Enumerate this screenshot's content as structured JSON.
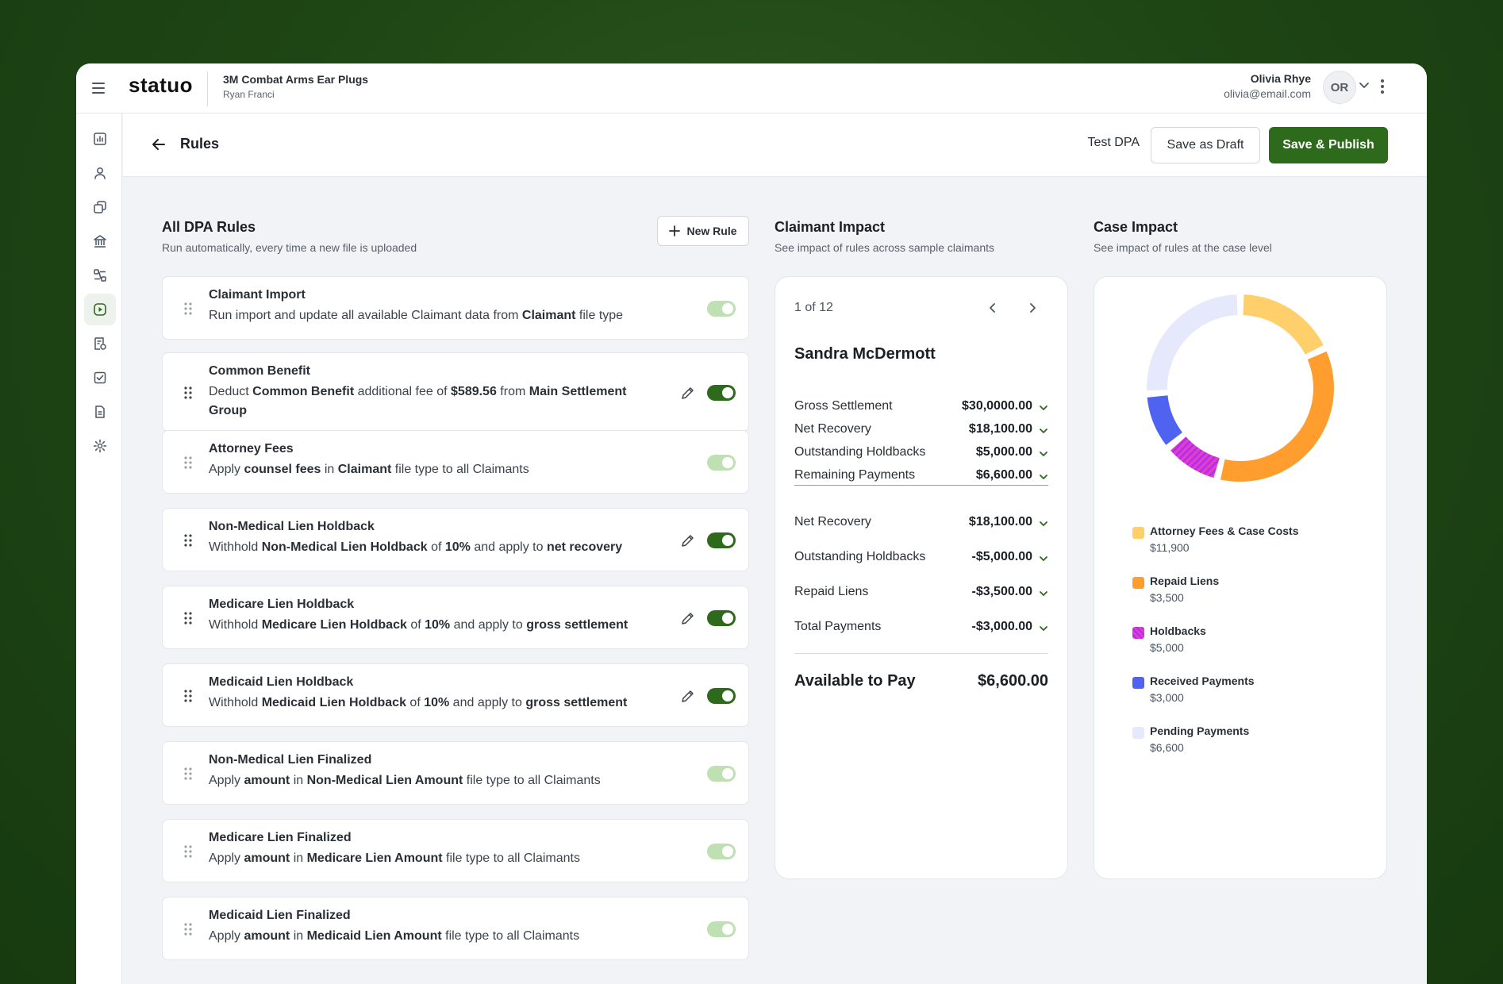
{
  "app": {
    "logo": "statuo",
    "case_title": "3M Combat Arms Ear Plugs",
    "case_subtitle": "Ryan Franci",
    "user_name": "Olivia Rhye",
    "user_email": "olivia@email.com",
    "avatar_initials": "OR"
  },
  "sidebar": {
    "icons": [
      "dashboard-icon",
      "user-icon",
      "copy-icon",
      "bank-icon",
      "workflow-icon",
      "play-icon",
      "receipt-icon",
      "checklist-icon",
      "document-icon",
      "settings-icon"
    ],
    "active_index": 5
  },
  "header": {
    "title": "Rules",
    "test_label": "Test DPA",
    "draft_label": "Save as Draft",
    "publish_label": "Save & Publish"
  },
  "rules_section": {
    "title": "All DPA Rules",
    "subtitle": "Run automatically, every time a new file is uploaded",
    "new_rule_label": "New Rule"
  },
  "rules": [
    {
      "title": "Claimant Import",
      "desc": [
        {
          "t": "Run import and update all available Claimant data from "
        },
        {
          "b": "Claimant"
        },
        {
          "t": " file type"
        }
      ],
      "toggle": "locked",
      "editable": false
    },
    {
      "title": "Common Benefit",
      "desc": [
        {
          "t": "Deduct "
        },
        {
          "b": "Common Benefit"
        },
        {
          "t": " additional fee of "
        },
        {
          "b": "$589.56"
        },
        {
          "t": " from "
        },
        {
          "b": "Main Settlement Group"
        }
      ],
      "toggle": "on",
      "editable": true
    },
    {
      "title": "Attorney Fees",
      "desc": [
        {
          "t": "Apply "
        },
        {
          "b": "counsel fees"
        },
        {
          "t": " in "
        },
        {
          "b": "Claimant"
        },
        {
          "t": " file type to all Claimants"
        }
      ],
      "toggle": "locked",
      "editable": false
    },
    {
      "title": "Non-Medical Lien Holdback",
      "desc": [
        {
          "t": "Withhold "
        },
        {
          "b": "Non-Medical Lien Holdback"
        },
        {
          "t": " of "
        },
        {
          "b": "10%"
        },
        {
          "t": " and apply to "
        },
        {
          "b": "net recovery"
        }
      ],
      "toggle": "on",
      "editable": true
    },
    {
      "title": "Medicare Lien Holdback",
      "desc": [
        {
          "t": "Withhold "
        },
        {
          "b": "Medicare Lien Holdback"
        },
        {
          "t": " of "
        },
        {
          "b": "10%"
        },
        {
          "t": " and apply to "
        },
        {
          "b": "gross settlement"
        }
      ],
      "toggle": "on",
      "editable": true
    },
    {
      "title": "Medicaid Lien Holdback",
      "desc": [
        {
          "t": "Withhold "
        },
        {
          "b": "Medicaid Lien Holdback"
        },
        {
          "t": " of "
        },
        {
          "b": "10%"
        },
        {
          "t": " and apply to "
        },
        {
          "b": "gross settlement"
        }
      ],
      "toggle": "on",
      "editable": true
    },
    {
      "title": "Non-Medical Lien Finalized",
      "desc": [
        {
          "t": "Apply "
        },
        {
          "b": "amount"
        },
        {
          "t": " in "
        },
        {
          "b": "Non-Medical Lien Amount"
        },
        {
          "t": " file type to all Claimants"
        }
      ],
      "toggle": "locked",
      "editable": false
    },
    {
      "title": "Medicare Lien Finalized",
      "desc": [
        {
          "t": "Apply "
        },
        {
          "b": "amount"
        },
        {
          "t": " in "
        },
        {
          "b": "Medicare Lien Amount"
        },
        {
          "t": " file type to all Claimants"
        }
      ],
      "toggle": "locked",
      "editable": false
    },
    {
      "title": "Medicaid Lien Finalized",
      "desc": [
        {
          "t": "Apply "
        },
        {
          "b": "amount"
        },
        {
          "t": " in "
        },
        {
          "b": "Medicaid Lien Amount"
        },
        {
          "t": " file type to all Claimants"
        }
      ],
      "toggle": "locked",
      "editable": false
    }
  ],
  "claimant_impact": {
    "title": "Claimant Impact",
    "subtitle": "See impact of rules across sample claimants",
    "pager": "1 of 12",
    "claimant_name": "Sandra McDermott",
    "summary_rows": [
      {
        "label": "Gross Settlement",
        "value": "$30,0000.00"
      },
      {
        "label": "Net Recovery",
        "value": "$18,100.00"
      },
      {
        "label": "Outstanding Holdbacks",
        "value": "$5,000.00"
      },
      {
        "label": "Remaining Payments",
        "value": "$6,600.00"
      }
    ],
    "detail_rows": [
      {
        "label": "Net Recovery",
        "value": "$18,100.00"
      },
      {
        "label": "Outstanding Holdbacks",
        "value": "-$5,000.00"
      },
      {
        "label": "Repaid Liens",
        "value": "-$3,500.00"
      },
      {
        "label": "Total Payments",
        "value": "-$3,000.00"
      }
    ],
    "available_label": "Available to Pay",
    "available_value": "$6,600.00"
  },
  "case_impact": {
    "title": "Case Impact",
    "subtitle": "See impact of rules at the case level"
  },
  "chart_data": {
    "type": "pie",
    "donut": true,
    "categories": [
      "Attorney Fees & Case Costs",
      "Repaid Liens",
      "Holdbacks",
      "Received Payments",
      "Pending Payments"
    ],
    "values": [
      11900,
      3500,
      5000,
      3000,
      6600
    ],
    "value_labels": [
      "$11,900",
      "$3,500",
      "$5,000",
      "$3,000",
      "$6,600"
    ],
    "slice_fractions": [
      0.18,
      0.36,
      0.1,
      0.1,
      0.26
    ],
    "colors": [
      "#ffcf6b",
      "#ff9d2e",
      "#e040c8",
      "#4f63f0",
      "#e6e8fb"
    ],
    "legend_placement": "below"
  }
}
